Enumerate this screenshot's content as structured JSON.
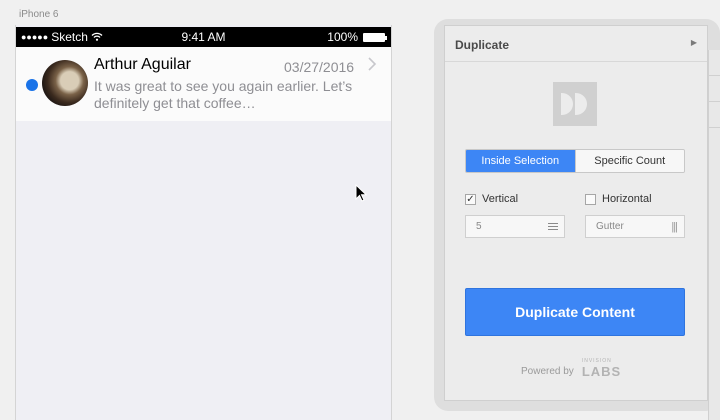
{
  "canvas": {
    "artboard_label": "iPhone 6"
  },
  "status_bar": {
    "signal_dots": "●●●●●",
    "carrier": "Sketch",
    "time": "9:41 AM",
    "battery": "100%"
  },
  "message": {
    "sender": "Arthur Aguilar",
    "date": "03/27/2016",
    "preview": "It was great to see you again earlier. Let’s definitely get that coffee…",
    "unread": true
  },
  "panel": {
    "title": "Duplicate",
    "mode_tabs": [
      "Inside Selection",
      "Specific Count"
    ],
    "active_tab": "Inside Selection",
    "vertical": {
      "label": "Vertical",
      "checked": true
    },
    "horizontal": {
      "label": "Horizontal",
      "checked": false
    },
    "count_value": "5",
    "gutter_placeholder": "Gutter",
    "primary_button": "Duplicate Content",
    "powered_by": "Powered by",
    "brand_small": "INVISION",
    "brand": "LABS"
  },
  "colors": {
    "accent": "#3d86f5",
    "unread_dot": "#1a73e8"
  }
}
